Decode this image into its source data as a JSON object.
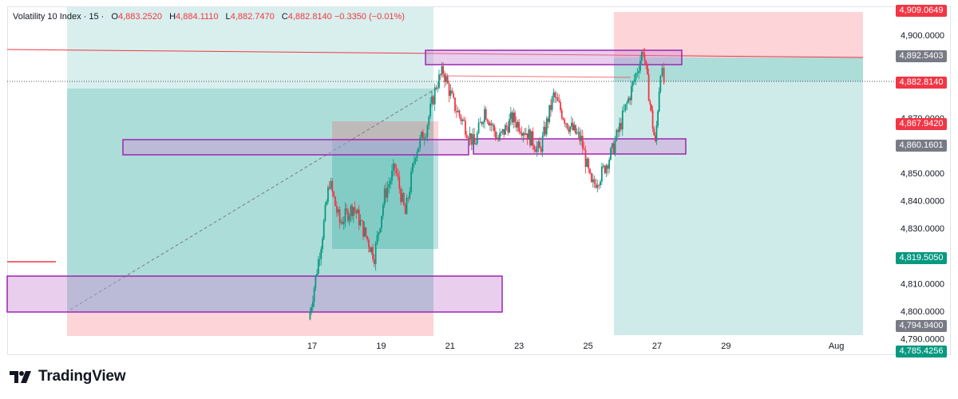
{
  "header": {
    "symbol": "Volatility 10 Index · 15 ·",
    "open_label": "O",
    "open": "4,883.2520",
    "high_label": "H",
    "high": "4,884.1110",
    "low_label": "L",
    "low": "4,882.7470",
    "close_label": "C",
    "close": "4,882.8140",
    "change": "−0.3350 (−0.01%)"
  },
  "brand": {
    "name": "TradingView"
  },
  "colors": {
    "up": "#089981",
    "down": "#f23645",
    "profit_zone": "#26a69a",
    "loss_zone": "#f7525f",
    "zone_fill": "#ce93d8",
    "zone_border": "#9c27b0",
    "axis_text": "#131722"
  },
  "chart_data": {
    "type": "candlestick",
    "y_axis_labels": [
      "4,900.0000",
      "4,870.0000",
      "4,850.0000",
      "4,840.0000",
      "4,830.0000",
      "4,810.0000",
      "4,800.0000",
      "4,790.0000"
    ],
    "x_axis_labels": [
      "17",
      "19",
      "21",
      "23",
      "25",
      "27",
      "29",
      "Aug"
    ],
    "price_tags": [
      {
        "text": "4,909.0649",
        "color": "#f23645"
      },
      {
        "text": "4,892.5403",
        "color": "#787b86"
      },
      {
        "text": "4,882.8140",
        "color": "#f23645"
      },
      {
        "text": "4,867.9420",
        "color": "#f23645"
      },
      {
        "text": "4,860.1601",
        "color": "#787b86"
      },
      {
        "text": "4,819.5050",
        "color": "#089981"
      },
      {
        "text": "4,794.9400",
        "color": "#787b86"
      },
      {
        "text": "4,785.4256",
        "color": "#089981"
      }
    ],
    "last_price": 4882.814,
    "price_path": [
      {
        "day": 16.9,
        "price": 4797
      },
      {
        "day": 17.1,
        "price": 4812
      },
      {
        "day": 17.3,
        "price": 4828
      },
      {
        "day": 17.5,
        "price": 4847
      },
      {
        "day": 17.8,
        "price": 4832
      },
      {
        "day": 18.2,
        "price": 4838
      },
      {
        "day": 18.6,
        "price": 4826
      },
      {
        "day": 18.8,
        "price": 4820
      },
      {
        "day": 19.1,
        "price": 4842
      },
      {
        "day": 19.4,
        "price": 4852
      },
      {
        "day": 19.7,
        "price": 4835
      },
      {
        "day": 20.0,
        "price": 4858
      },
      {
        "day": 20.3,
        "price": 4866
      },
      {
        "day": 20.6,
        "price": 4882
      },
      {
        "day": 20.8,
        "price": 4887
      },
      {
        "day": 21.1,
        "price": 4875
      },
      {
        "day": 21.4,
        "price": 4868
      },
      {
        "day": 21.7,
        "price": 4860
      },
      {
        "day": 22.0,
        "price": 4873
      },
      {
        "day": 22.4,
        "price": 4862
      },
      {
        "day": 22.8,
        "price": 4870
      },
      {
        "day": 23.2,
        "price": 4865
      },
      {
        "day": 23.6,
        "price": 4858
      },
      {
        "day": 24.0,
        "price": 4878
      },
      {
        "day": 24.4,
        "price": 4868
      },
      {
        "day": 24.8,
        "price": 4862
      },
      {
        "day": 25.1,
        "price": 4845
      },
      {
        "day": 25.4,
        "price": 4850
      },
      {
        "day": 25.7,
        "price": 4858
      },
      {
        "day": 26.0,
        "price": 4870
      },
      {
        "day": 26.3,
        "price": 4882
      },
      {
        "day": 26.6,
        "price": 4895
      },
      {
        "day": 26.8,
        "price": 4875
      },
      {
        "day": 26.95,
        "price": 4860
      },
      {
        "day": 27.1,
        "price": 4888
      },
      {
        "day": 27.2,
        "price": 4882.8
      }
    ]
  }
}
